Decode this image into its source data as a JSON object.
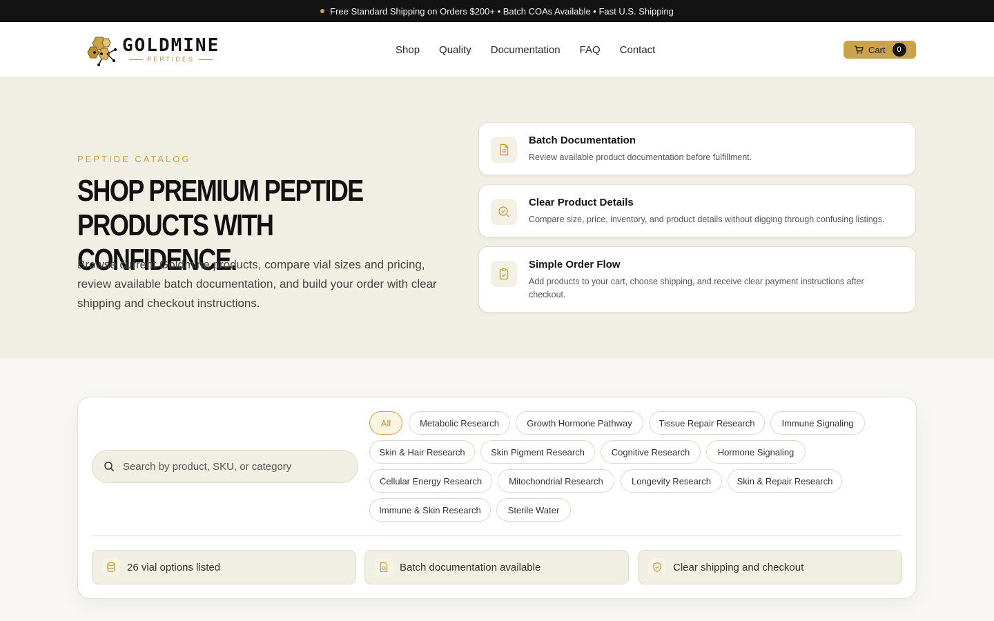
{
  "announcement": {
    "text": "Free Standard Shipping on Orders $200+ • Batch COAs Available • Fast U.S. Shipping"
  },
  "brand": {
    "name": "GOLDMINE",
    "tagline": "PEPTIDES",
    "accent_color": "#c9a24a",
    "logo_icon": "honeycomb-molecule-icon"
  },
  "nav": {
    "items": [
      "Shop",
      "Quality",
      "Documentation",
      "FAQ",
      "Contact"
    ]
  },
  "cart": {
    "label": "Cart",
    "count": "0",
    "icon": "cart-icon"
  },
  "hero": {
    "eyebrow": "PEPTIDE CATALOG",
    "title": "Shop Premium Peptide Products With Confidence.",
    "description": "Browse current Goldmine products, compare vial sizes and pricing, review available batch documentation, and build your order with clear shipping and checkout instructions.",
    "features": [
      {
        "title": "Batch Documentation",
        "description": "Review available product documentation before fulfillment.",
        "icon": "document-icon"
      },
      {
        "title": "Clear Product Details",
        "description": "Compare size, price, inventory, and product details without digging through confusing listings.",
        "icon": "search-check-icon"
      },
      {
        "title": "Simple Order Flow",
        "description": "Add products to your cart, choose shipping, and receive clear payment instructions after checkout.",
        "icon": "clipboard-check-icon"
      }
    ]
  },
  "filters": {
    "search_placeholder": "Search by product, SKU, or category",
    "search_value": "",
    "categories": [
      "All",
      "Metabolic Research",
      "Growth Hormone Pathway",
      "Tissue Repair Research",
      "Immune Signaling",
      "Skin & Hair Research",
      "Skin Pigment Research",
      "Cognitive Research",
      "Hormone Signaling",
      "Cellular Energy Research",
      "Mitochondrial Research",
      "Longevity Research",
      "Skin & Repair Research",
      "Immune & Skin Research",
      "Sterile Water"
    ],
    "active_category": "All"
  },
  "stats": [
    {
      "label": "26 vial options listed",
      "icon": "database-icon"
    },
    {
      "label": "Batch documentation available",
      "icon": "file-badge-icon"
    },
    {
      "label": "Clear shipping and checkout",
      "icon": "shield-check-icon"
    }
  ]
}
